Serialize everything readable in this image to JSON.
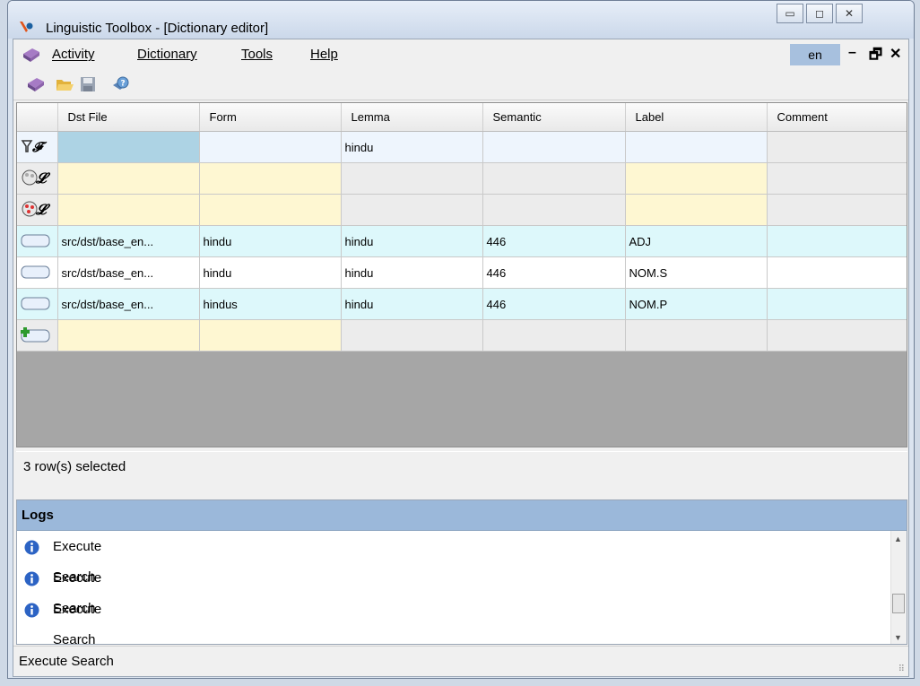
{
  "window": {
    "title": "Linguistic Toolbox - [Dictionary editor]"
  },
  "menu": {
    "items": [
      "Activity",
      "Dictionary",
      "Tools",
      "Help"
    ],
    "language": "en"
  },
  "grid": {
    "columns": [
      "Dst File",
      "Form",
      "Lemma",
      "Semantic",
      "Label",
      "Comment"
    ],
    "filter_row": [
      "",
      "",
      "hindu",
      "",
      "",
      ""
    ],
    "rows": [
      [
        "src/dst/base_en...",
        "hindu",
        "hindu",
        "446",
        "ADJ",
        ""
      ],
      [
        "src/dst/base_en...",
        "hindu",
        "hindu",
        "446",
        "NOM.S",
        ""
      ],
      [
        "src/dst/base_en...",
        "hindus",
        "hindu",
        "446",
        "NOM.P",
        ""
      ]
    ],
    "selection_status": "3 row(s) selected"
  },
  "logs": {
    "title": "Logs",
    "entries": [
      "Execute Search",
      "Execute Search",
      "Execute Search"
    ]
  },
  "status": {
    "text": "Execute Search"
  },
  "colors": {
    "accent": "#9bb8da",
    "filter_cell": "#add3e4",
    "row_cyan": "#ddf8fb",
    "row_yellow": "#fef7d2"
  }
}
